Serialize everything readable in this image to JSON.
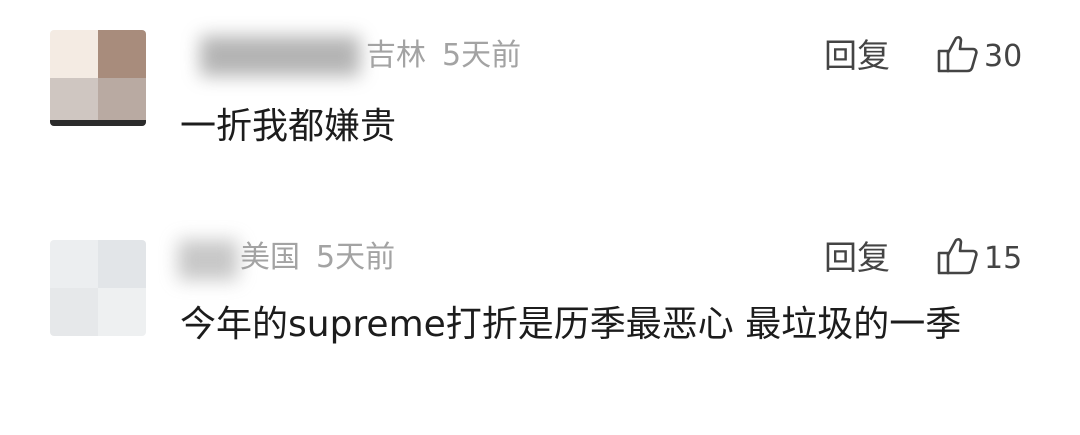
{
  "comments": [
    {
      "location": "吉林",
      "time": "5天前",
      "reply_label": "回复",
      "like_count": "30",
      "text": "一折我都嫌贵"
    },
    {
      "location": "美国",
      "time": "5天前",
      "reply_label": "回复",
      "like_count": "15",
      "text": "今年的supreme打折是历季最恶心 最垃圾的一季"
    }
  ],
  "icons": {
    "like": "thumbs-up-icon"
  },
  "colors": {
    "meta_text": "#a3a3a3",
    "action_text": "#444444",
    "body_text": "#1c1c1c"
  }
}
